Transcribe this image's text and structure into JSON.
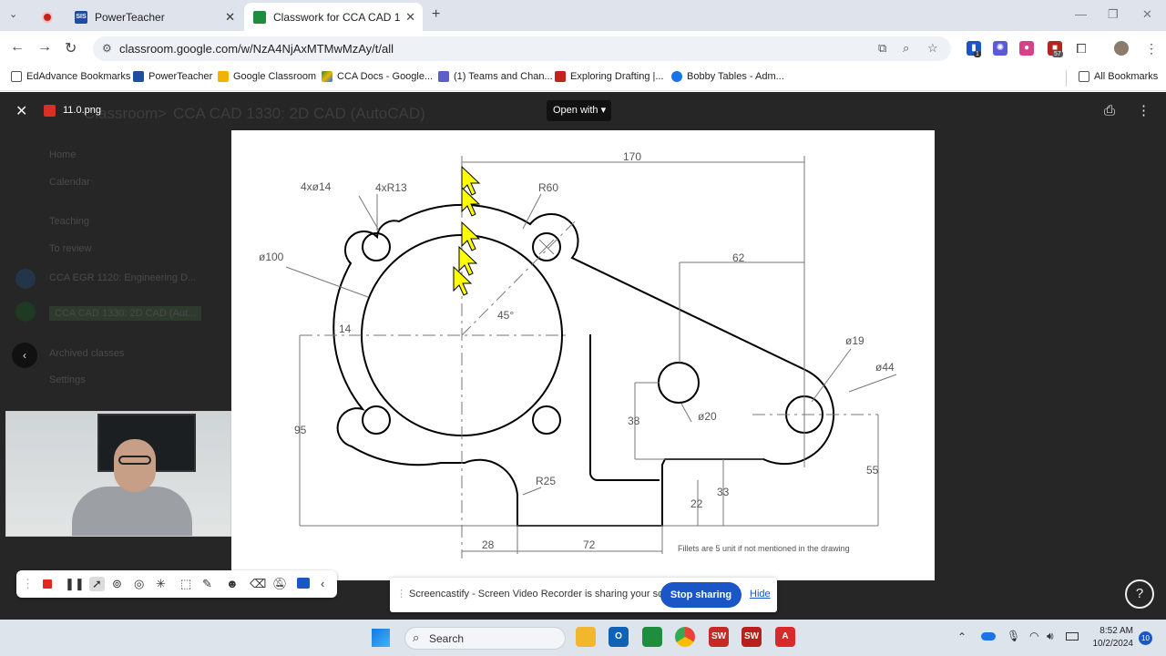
{
  "browser": {
    "tabs": [
      {
        "label": "",
        "active": false
      },
      {
        "label": "PowerTeacher",
        "active": false
      },
      {
        "label": "Classwork for CCA CAD 1330: 2",
        "active": true
      }
    ],
    "url": "classroom.google.com/w/NzA4NjAxMTMwMzAy/t/all",
    "ext_badges": {
      "first": "1",
      "second": "57"
    }
  },
  "bookmarks": [
    {
      "label": "EdAdvance Bookmarks"
    },
    {
      "label": "PowerTeacher"
    },
    {
      "label": "Google Classroom"
    },
    {
      "label": "CCA Docs - Google..."
    },
    {
      "label": "(1) Teams and Chan..."
    },
    {
      "label": "Exploring Drafting |..."
    },
    {
      "label": "Bobby Tables - Adm..."
    },
    {
      "label": "All Bookmarks"
    }
  ],
  "viewer": {
    "file_name": "11.0.png",
    "open_with": "Open with"
  },
  "background_classroom": {
    "breadcrumb_a": "Classroom",
    "breadcrumb_b": "CCA CAD 1330: 2D CAD (AutoCAD)",
    "nav": [
      "Home",
      "Calendar",
      "Teaching",
      "To review",
      "CCA EGR 1120: Engineering D...",
      "CCA CAD 1330: 2D CAD (Aut...",
      "Archived classes",
      "Settings"
    ]
  },
  "drawing": {
    "dims": {
      "d170": "170",
      "d62": "62",
      "holes4": "4xø14",
      "r13": "4xR13",
      "r60": "R60",
      "d100": "ø100",
      "a45": "45°",
      "d14": "14",
      "d95": "95",
      "d19": "ø19",
      "d44": "ø44",
      "d38": "38",
      "d20": "ø20",
      "r25": "R25",
      "d22": "22",
      "d33": "33",
      "d55": "55",
      "d28": "28",
      "d72": "72"
    },
    "note": "Fillets are 5 unit if not mentioned in the drawing"
  },
  "screencastify": {
    "message": "Screencastify - Screen Video Recorder is sharing your screen.",
    "stop": "Stop sharing",
    "hide": "Hide"
  },
  "taskbar": {
    "search": "Search",
    "time": "8:52 AM",
    "date": "10/2/2024",
    "notif_count": "10"
  }
}
